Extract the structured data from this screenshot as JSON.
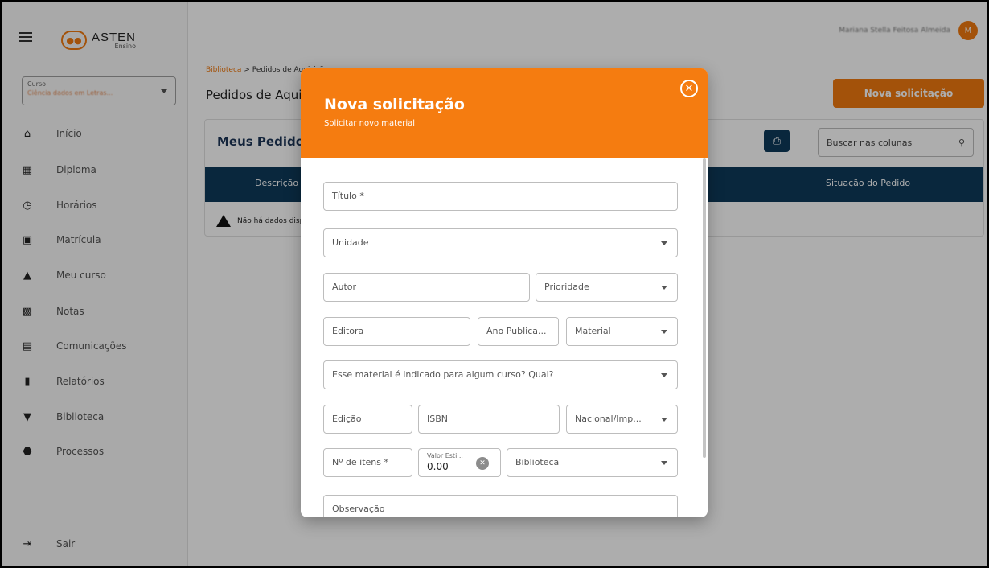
{
  "brand": {
    "logo_text": "ASTEN",
    "logo_sub": "Ensino",
    "colors": {
      "accent": "#f57c10",
      "navy": "#0e3a5b"
    }
  },
  "sidebar": {
    "menu_icon": "hamburger-icon",
    "course": {
      "label": "Curso",
      "value": "Ciência dados em Letras..."
    },
    "items": [
      {
        "label": "Início",
        "icon": "home-icon"
      },
      {
        "label": "Diploma",
        "icon": "diploma-icon"
      },
      {
        "label": "Horários",
        "icon": "calendar-clock-icon"
      },
      {
        "label": "Matrícula",
        "icon": "document-icon"
      },
      {
        "label": "Meu curso",
        "icon": "graduation-cap-icon"
      },
      {
        "label": "Notas",
        "icon": "grades-card-icon"
      },
      {
        "label": "Comunicações",
        "icon": "message-icon"
      },
      {
        "label": "Relatórios",
        "icon": "report-icon"
      },
      {
        "label": "Biblioteca",
        "icon": "reader-icon"
      },
      {
        "label": "Processos",
        "icon": "box-icon"
      }
    ],
    "logout": {
      "label": "Sair",
      "icon": "logout-icon"
    }
  },
  "header": {
    "user_name": "Mariana Stella Feitosa Almeida",
    "avatar_initials": "M"
  },
  "main": {
    "breadcrumb": {
      "root": "Biblioteca",
      "separator": ">",
      "current": "Pedidos de Aquisição"
    },
    "page_title": "Pedidos de Aquisição",
    "new_button": "Nova solicitação",
    "card": {
      "title": "Meus Pedidos",
      "search_placeholder": "Buscar nas colunas",
      "columns": [
        "Descrição",
        "Situação do Pedido"
      ],
      "empty_text": "Não há dados disponíveis"
    }
  },
  "modal": {
    "title": "Nova solicitação",
    "subtitle": "Solicitar novo material",
    "fields": {
      "titulo": "Título *",
      "unidade": "Unidade",
      "autor": "Autor",
      "prioridade": "Prioridade",
      "editora": "Editora",
      "ano": "Ano Publica...",
      "material": "Material",
      "indicado": "Esse material é indicado para algum curso? Qual?",
      "edicao": "Edição",
      "isbn": "ISBN",
      "nacional": "Nacional/Imp...",
      "n_itens": "Nº de itens *",
      "valor_label": "Valor Esti...",
      "valor_value": "0.00",
      "biblioteca": "Biblioteca",
      "observacao": "Observação"
    }
  }
}
